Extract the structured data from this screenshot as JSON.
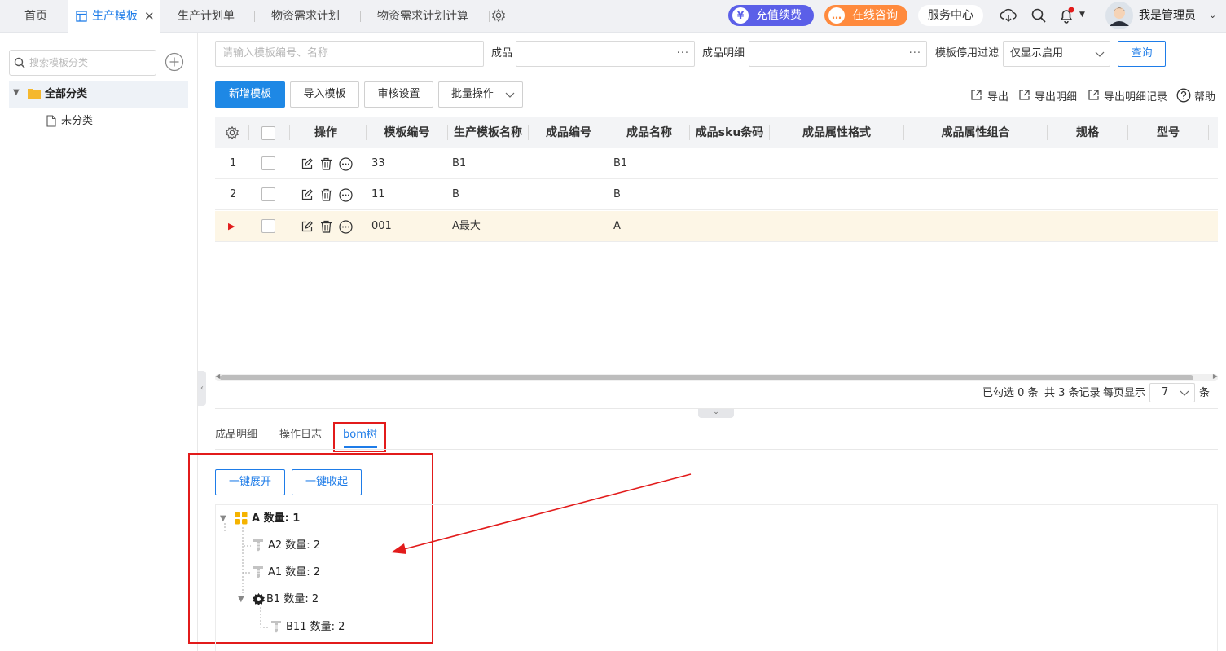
{
  "topbar": {
    "tabs": [
      {
        "label": "首页"
      },
      {
        "label": "生产模板",
        "active": true
      },
      {
        "label": "生产计划单"
      },
      {
        "label": "物资需求计划"
      },
      {
        "label": "物资需求计划计算"
      }
    ],
    "recharge_label": "充值续费",
    "consult_label": "在线咨询",
    "service_label": "服务中心",
    "user_name": "我是管理员"
  },
  "sidebar": {
    "search_placeholder": "搜索模板分类",
    "tree_root": "全部分类",
    "tree_child": "未分类"
  },
  "filters": {
    "keyword_placeholder": "请输入模板编号、名称",
    "product_label": "成品",
    "product_detail_label": "成品明细",
    "disable_filter_label": "模板停用过滤",
    "disable_filter_value": "仅显示启用",
    "query_label": "查询"
  },
  "toolbar": {
    "add_label": "新增模板",
    "import_label": "导入模板",
    "audit_label": "审核设置",
    "batch_label": "批量操作",
    "export_label": "导出",
    "export_detail_label": "导出明细",
    "export_detail_record_label": "导出明细记录",
    "help_label": "帮助"
  },
  "table": {
    "columns": [
      "操作",
      "模板编号",
      "生产模板名称",
      "成品编号",
      "成品名称",
      "成品sku条码",
      "成品属性格式",
      "成品属性组合",
      "规格",
      "型号"
    ],
    "rows": [
      {
        "index": "1",
        "code": "33",
        "name": "B1",
        "product_code": "",
        "product_name": "B1"
      },
      {
        "index": "2",
        "code": "11",
        "name": "B",
        "product_code": "",
        "product_name": "B"
      },
      {
        "index": "",
        "code": "001",
        "name": "A最大",
        "product_code": "",
        "product_name": "A",
        "selected": true
      }
    ]
  },
  "pagination": {
    "selected_text": "已勾选 0 条",
    "total_text": "共 3 条记录",
    "per_page_label": "每页显示",
    "per_page_value": "7",
    "unit": "条"
  },
  "bottom_tabs": [
    {
      "label": "成品明细"
    },
    {
      "label": "操作日志"
    },
    {
      "label": "bom树",
      "active": true
    }
  ],
  "bom": {
    "expand_all_label": "一键展开",
    "collapse_all_label": "一键收起",
    "nodes": {
      "root": "A 数量: 1",
      "a2": "A2 数量: 2",
      "a1": "A1 数量: 2",
      "b1": "B1 数量: 2",
      "b11": "B11 数量: 2"
    }
  },
  "colors": {
    "accent": "#1e7ce8",
    "recharge": "#5b5fe8",
    "consult": "#ff8a3d",
    "highlight_red": "#e21b1b",
    "selected_row": "#fdf6e6"
  }
}
